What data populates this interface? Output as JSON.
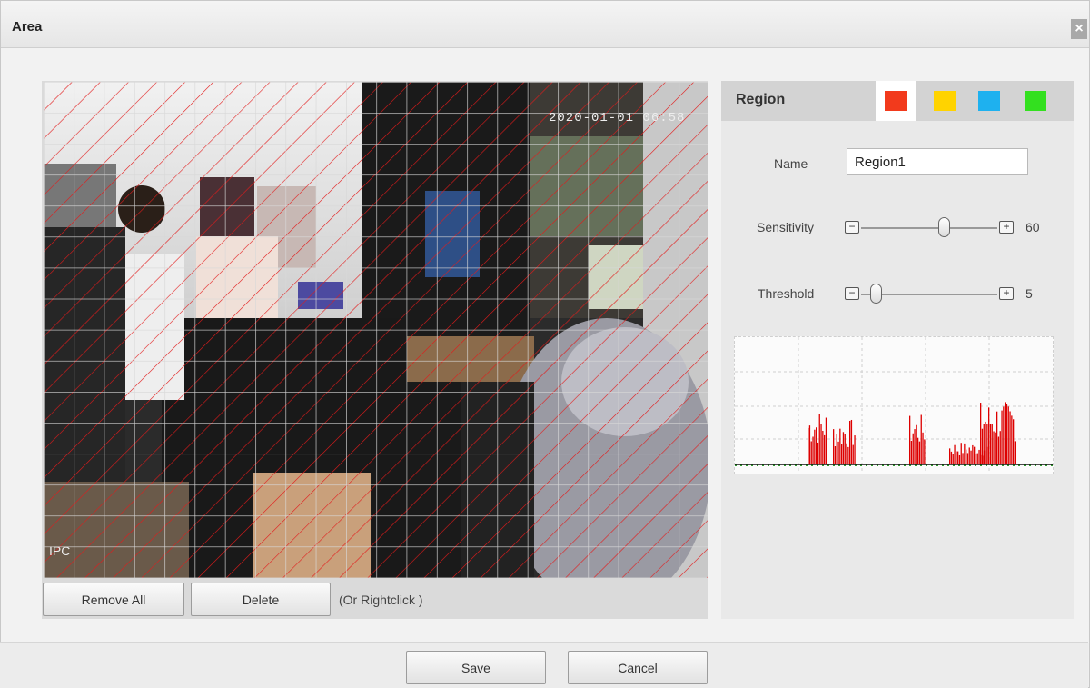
{
  "dialog": {
    "title": "Area",
    "close_glyph": "×"
  },
  "video": {
    "timestamp_overlay": "2020-01-01 06:58",
    "channel_overlay": "IPC",
    "remove_all_label": "Remove All",
    "delete_label": "Delete",
    "hint": "(Or Rightclick )"
  },
  "panel": {
    "region_label": "Region",
    "swatches": [
      {
        "color": "#f23a1c",
        "selected": true
      },
      {
        "color": "#ffd300"
      },
      {
        "color": "#1eb1ef"
      },
      {
        "color": "#33e01f"
      }
    ],
    "name_label": "Name",
    "name_value": "Region1",
    "sensitivity_label": "Sensitivity",
    "sensitivity_value": "60",
    "threshold_label": "Threshold",
    "threshold_value": "5",
    "minus_glyph": "−",
    "plus_glyph": "+"
  },
  "footer": {
    "save_label": "Save",
    "cancel_label": "Cancel"
  },
  "colors": {
    "hatch": "#e21a1a",
    "grid": "#cfcfcf",
    "graph_bars": "#dd0000",
    "graph_low": "#2e9b2e"
  }
}
